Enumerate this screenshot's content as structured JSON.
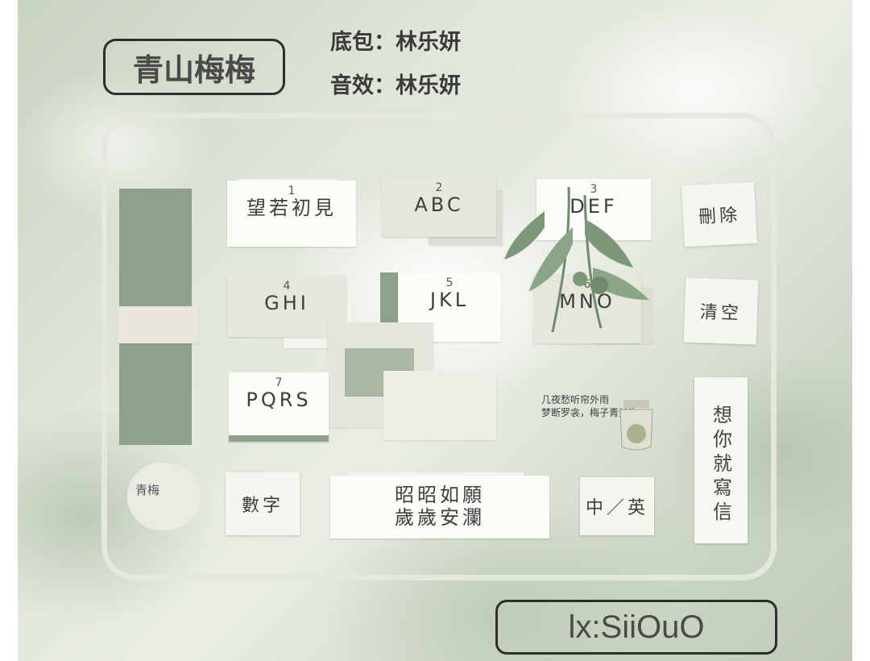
{
  "title": "青山梅梅",
  "credits": {
    "base": "底包：林乐妍",
    "sound": "音效：林乐妍"
  },
  "keys": [
    {
      "num": "1",
      "label": "望若初見"
    },
    {
      "num": "2",
      "label": "ABC"
    },
    {
      "num": "3",
      "label": "DEF"
    },
    {
      "num": "4",
      "label": "GHI"
    },
    {
      "num": "5",
      "label": "JKL"
    },
    {
      "num": "6",
      "label": "MNO"
    },
    {
      "num": "7",
      "label": "PQRS"
    }
  ],
  "side_keys": {
    "delete": "刪除",
    "clear": "清空",
    "vertical": "想你就寫信"
  },
  "bottom_keys": {
    "numbers": "數字",
    "space_line1": "昭昭如願",
    "space_line2": "歲歲安瀾",
    "lang": "中／英"
  },
  "poem": {
    "line1": "几夜愁听帘外雨",
    "line2": "梦断罗衾，梅子青如许"
  },
  "stamp_text": "青梅",
  "contact": "lx:SiiOuO",
  "colors": {
    "sage": "#8ea18b",
    "paper": "#fbfbf7",
    "tan": "#e7e6dc"
  }
}
